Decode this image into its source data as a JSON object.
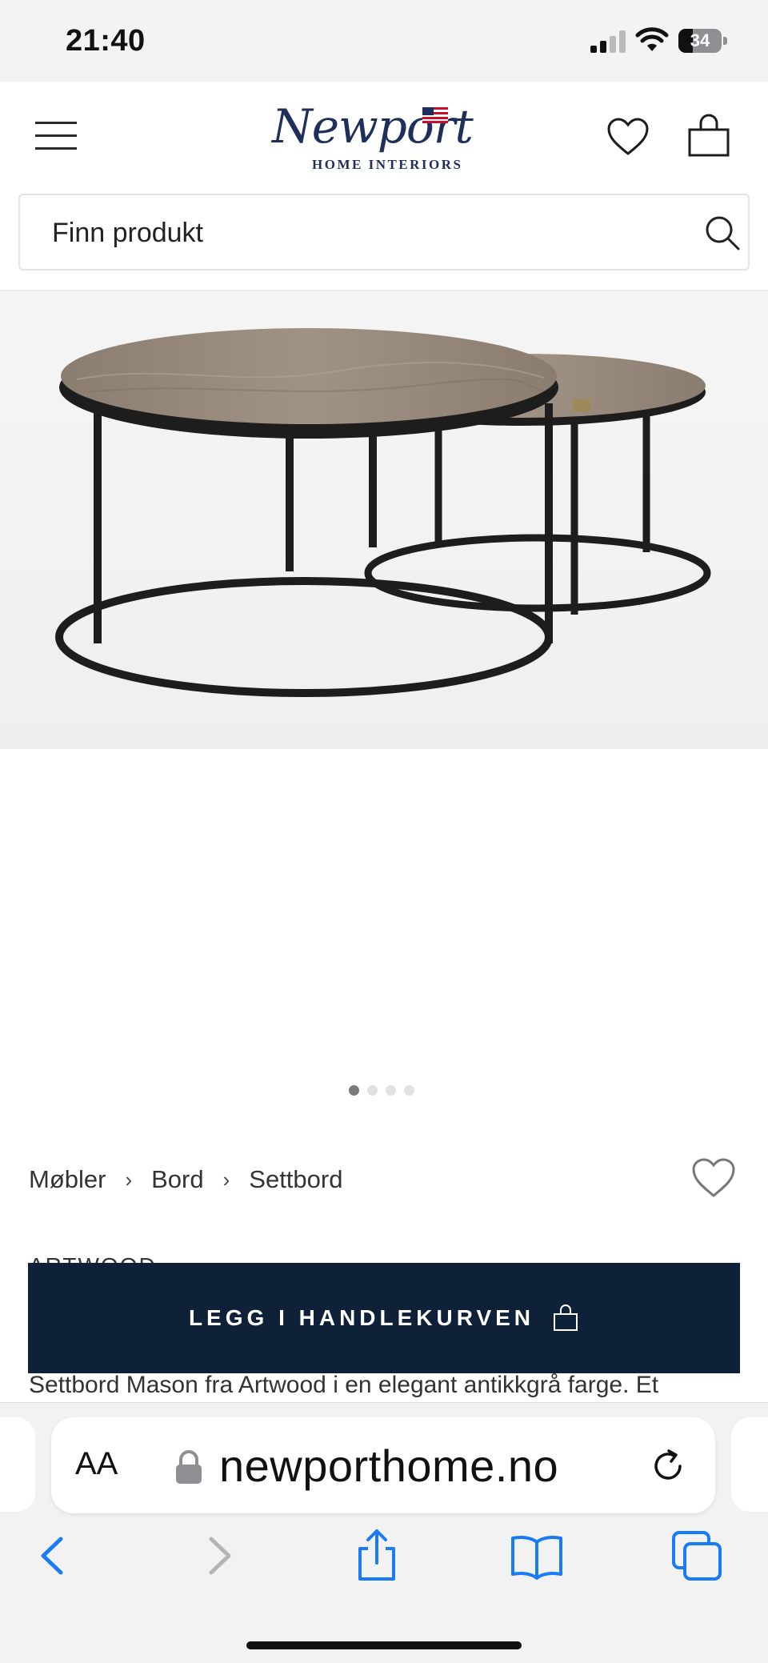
{
  "status_bar": {
    "time": "21:40",
    "battery": "34",
    "battery_level": 0.34
  },
  "header": {
    "logo": {
      "wordmark": "Newport",
      "tagline": "HOME INTERIORS"
    }
  },
  "search": {
    "placeholder": "Finn produkt"
  },
  "product": {
    "carousel": {
      "total": 4,
      "active_index": 0
    },
    "breadcrumb": [
      "Møbler",
      "Bord",
      "Settbord"
    ],
    "breadcrumb_separator": "›",
    "brand": "ARTWOOD",
    "description": "Settbord Mason fra Artwood i en elegant antikkgrå farge. Et"
  },
  "cart": {
    "add_label": "LEGG I HANDLEKURVEN"
  },
  "browser": {
    "aa_label": "AA",
    "url": "newporthome.no"
  },
  "colors": {
    "brand_navy": "#0f2039",
    "logo_blue": "#1f2f5c",
    "ios_blue": "#1a7cf4"
  }
}
